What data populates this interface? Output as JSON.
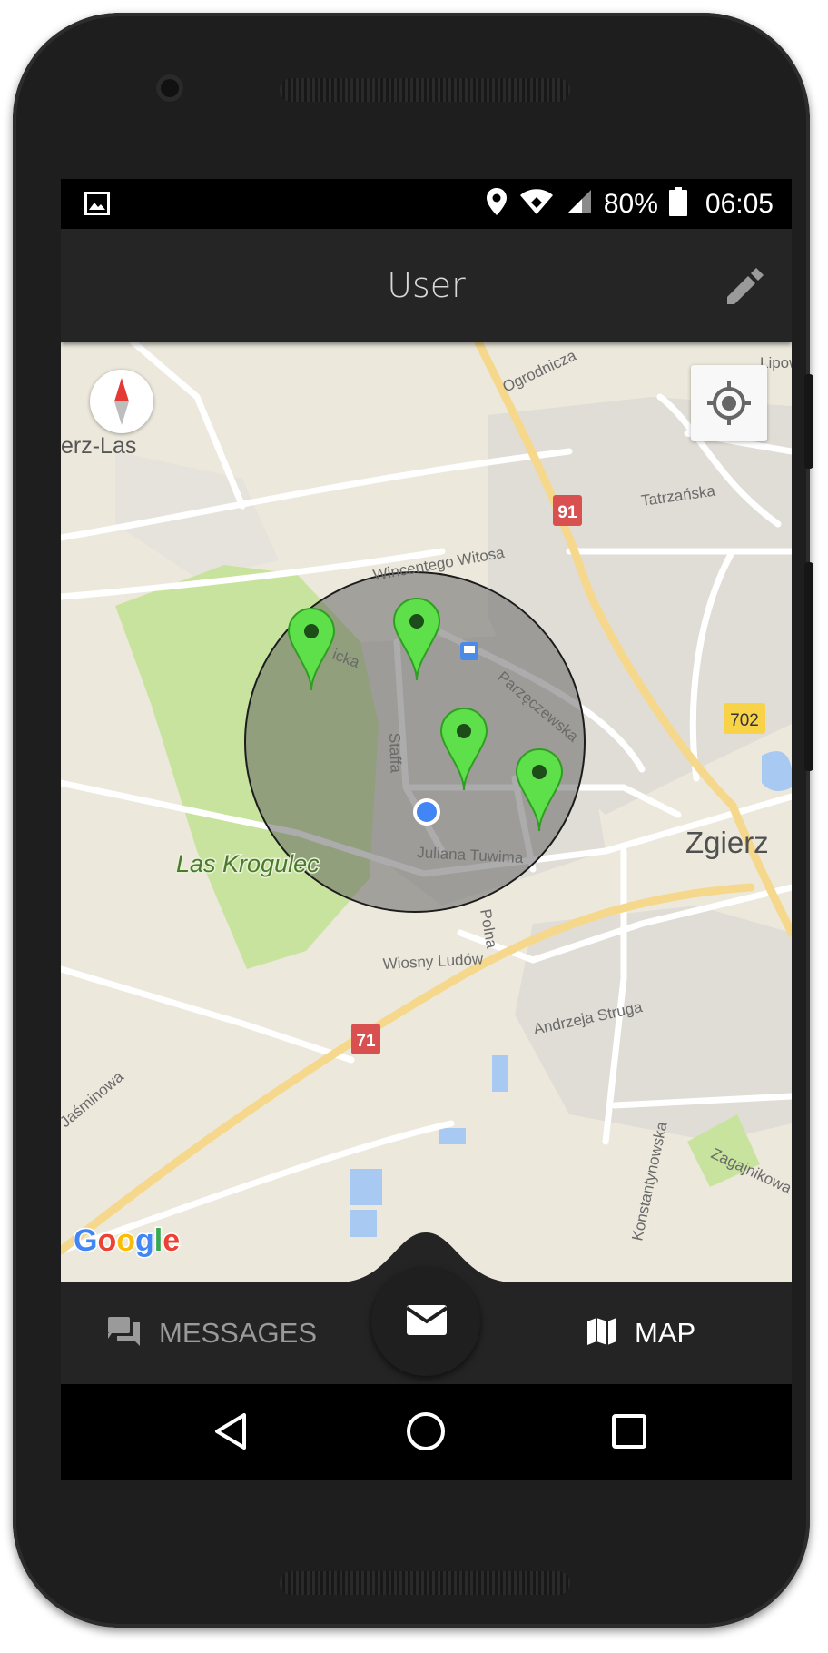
{
  "status_bar": {
    "battery": "80%",
    "time": "06:05",
    "icons": [
      "image-icon",
      "location-icon",
      "wifi-icon",
      "signal-icon",
      "battery-icon"
    ]
  },
  "app_bar": {
    "title": "User",
    "action_icon": "edit-pencil-icon"
  },
  "map": {
    "place_labels": {
      "town": "Zgierz",
      "forest": "Las Krogulec",
      "village": "erz-Las",
      "corner": "Lipow"
    },
    "street_labels": {
      "ogrodnicza": "Ogrodnicza",
      "tatrzanska": "Tatrzańska",
      "witosa": "Wincentego Witosa",
      "icka": "icka",
      "parzeczewska": "Parzęczewska",
      "staffa": "Staffa",
      "tuwima": "Juliana Tuwima",
      "polna": "Polna",
      "wiosny": "Wiosny Ludów",
      "struga": "Andrzeja Struga",
      "jasminowa": "Jaśminowa",
      "konstantynowska": "Konstantynowska",
      "zagajnikowa": "Zagajnikowa"
    },
    "road_shields": {
      "r91": "91",
      "r702": "702",
      "r71": "71"
    },
    "attribution": {
      "g": "G",
      "o1": "o",
      "o2": "o",
      "g2": "g",
      "l": "l",
      "e": "e"
    },
    "marker_count": 4,
    "colors": {
      "marker": "#5ee04a",
      "radius_fill": "#5f5f5f",
      "user_dot": "#4285f4",
      "park": "#c8e39e",
      "highway": "#f6d88d",
      "shield_red": "#d95050",
      "shield_yellow": "#f8d347"
    }
  },
  "bottom_nav": {
    "messages_label": "MESSAGES",
    "map_label": "MAP",
    "fab_icon": "mail-icon",
    "active": "MAP"
  },
  "system_nav": {
    "icons": [
      "back-icon",
      "home-icon",
      "recents-icon"
    ]
  }
}
